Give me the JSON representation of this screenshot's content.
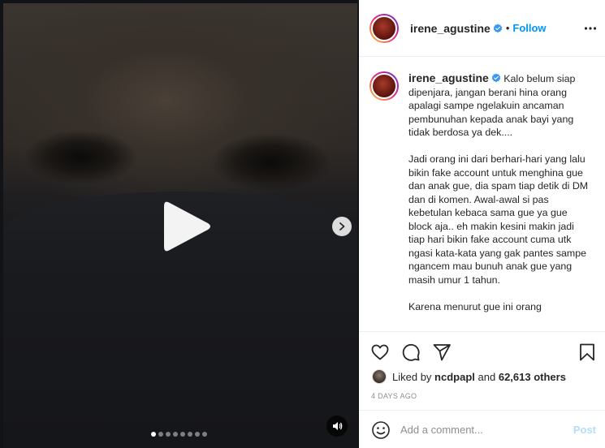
{
  "post": {
    "username": "irene_agustine",
    "verified": true,
    "follow_separator": "•",
    "follow_label": "Follow",
    "caption": "Kalo belum siap dipenjara, jangan berani hina orang apalagi sampe ngelakuin ancaman pembunuhan kepada anak bayi yang tidak berdosa ya dek....\n\nJadi orang ini dari berhari-hari yang lalu bikin fake account untuk menghina gue dan anak gue, dia spam tiap detik di DM dan di komen. Awal-awal si pas kebetulan kebaca sama gue ya gue block aja.. eh makin kesini makin jadi tiap hari bikin fake account cuma utk ngasi kata-kata yang gak pantes sampe ngancem mau bunuh anak gue yang masih umur 1 tahun.\n\nKarena menurut gue ini orang",
    "likes": {
      "prefix": "Liked by",
      "user": "ncdpapl",
      "conjunction": "and",
      "others": "62,613 others"
    },
    "date": "4 DAYS AGO"
  },
  "media": {
    "carousel_total": 8,
    "carousel_active": 0,
    "icons": {
      "play": "play-icon",
      "next": "chevron-right-icon",
      "sound": "speaker-icon"
    }
  },
  "actions": {
    "icons": [
      "heart-icon",
      "comment-icon",
      "share-icon",
      "bookmark-icon"
    ]
  },
  "comment": {
    "placeholder": "Add a comment...",
    "post_label": "Post"
  },
  "colors": {
    "link": "#0095f6",
    "post_disabled": "#b2dffc",
    "verified": "#3897f0"
  }
}
